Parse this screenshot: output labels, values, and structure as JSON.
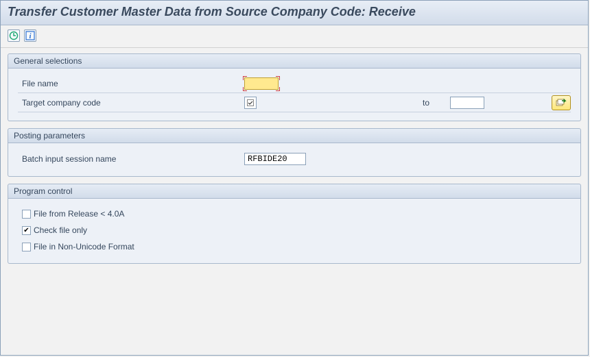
{
  "title": "Transfer Customer Master Data from Source Company Code: Receive",
  "groups": {
    "general": {
      "header": "General selections",
      "file_name_label": "File name",
      "target_company_label": "Target company code",
      "to_label": "to",
      "target_company_value": "",
      "target_company_to_value": ""
    },
    "posting": {
      "header": "Posting parameters",
      "batch_label": "Batch input session name",
      "batch_value": "RFBIDE20"
    },
    "program": {
      "header": "Program control",
      "cb1_label": "File from Release < 4.0A",
      "cb1_checked": false,
      "cb2_label": "Check file only",
      "cb2_checked": true,
      "cb3_label": "File in Non-Unicode Format",
      "cb3_checked": false
    }
  },
  "icons": {
    "execute": "⏱",
    "info": "i",
    "check": "☑",
    "multi_arrow": "➜"
  }
}
